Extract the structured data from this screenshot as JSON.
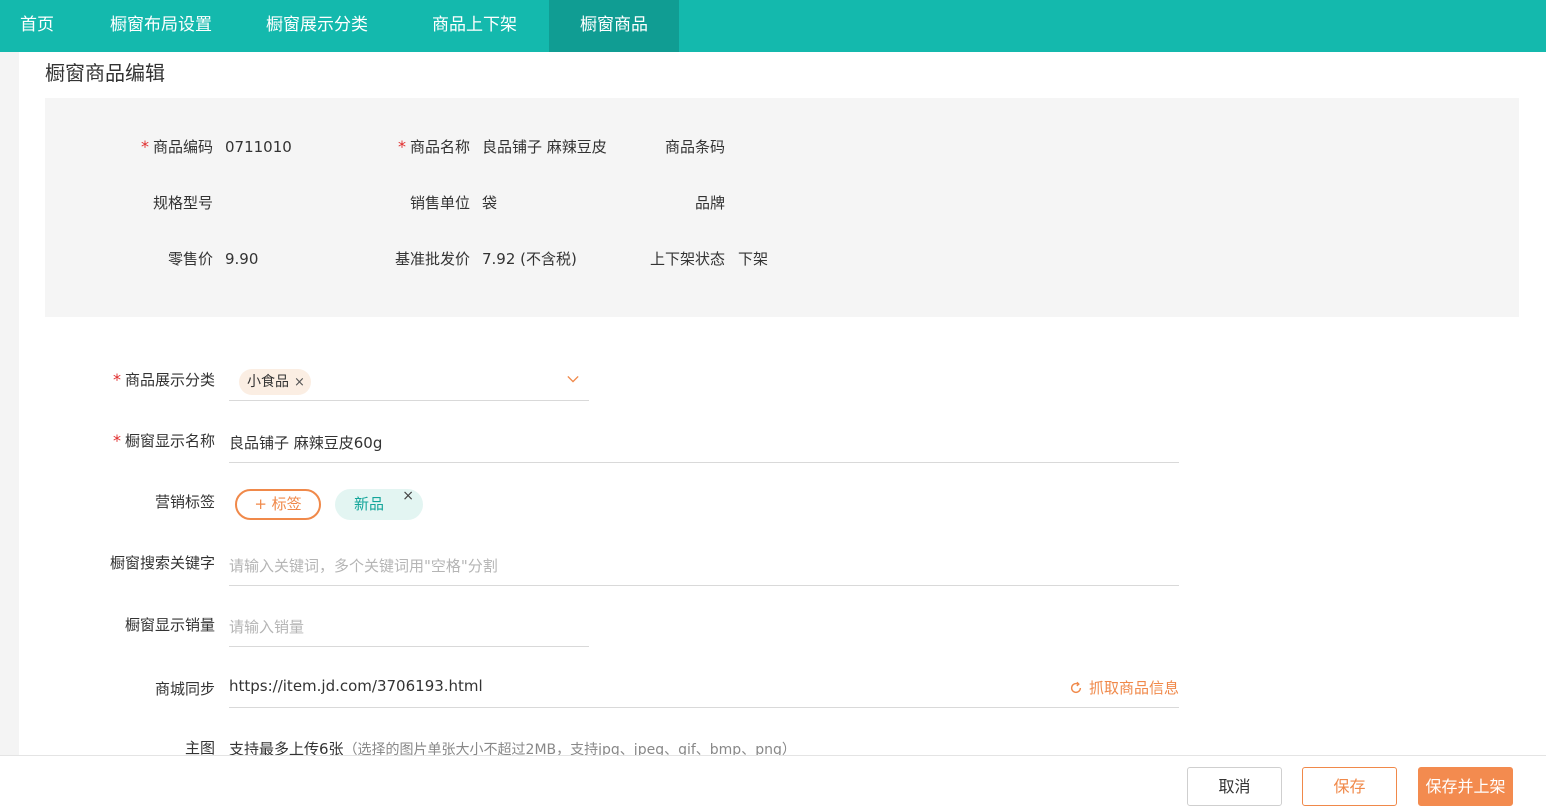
{
  "nav": {
    "items": [
      {
        "label": "首页",
        "active": false
      },
      {
        "label": "橱窗布局设置",
        "active": false
      },
      {
        "label": "橱窗展示分类",
        "active": false
      },
      {
        "label": "商品上下架",
        "active": false
      },
      {
        "label": "橱窗商品",
        "active": true
      }
    ]
  },
  "page": {
    "title": "橱窗商品编辑"
  },
  "info": {
    "required_mark": "*",
    "code_label": "商品编码",
    "code_value": "0711010",
    "name_label": "商品名称",
    "name_value": "良品铺子 麻辣豆皮",
    "barcode_label": "商品条码",
    "barcode_value": "",
    "spec_label": "规格型号",
    "spec_value": "",
    "unit_label": "销售单位",
    "unit_value": "袋",
    "brand_label": "品牌",
    "brand_value": "",
    "retail_label": "零售价",
    "retail_value": "9.90",
    "wholesale_label": "基准批发价",
    "wholesale_value": "7.92 (不含税)",
    "status_label": "上下架状态",
    "status_value": "下架"
  },
  "form": {
    "category_label": "商品展示分类",
    "category_chip": "小食品",
    "chip_remove": "×",
    "display_name_label": "橱窗显示名称",
    "display_name_value": "良品铺子 麻辣豆皮60g",
    "tags_label": "营销标签",
    "tag_add_label": "+ 标签",
    "tags": [
      {
        "label": "新品"
      }
    ],
    "keywords_label": "橱窗搜索关键字",
    "keywords_placeholder": "请输入关键词，多个关键词用\"空格\"分割",
    "sales_label": "橱窗显示销量",
    "sales_placeholder": "请输入销量",
    "sync_label": "商城同步",
    "sync_value": "https://item.jd.com/3706193.html",
    "fetch_label": "抓取商品信息",
    "main_image_label": "主图",
    "upload_tip": "支持最多上传6张",
    "upload_sub": "（选择的图片单张大小不超过2MB，支持jpg、jpeg、gif、bmp、png）"
  },
  "footer": {
    "cancel_label": "取消",
    "save_label": "保存",
    "publish_label": "保存并上架"
  },
  "colors": {
    "nav_bg": "#14b9ad",
    "nav_active": "#109d93",
    "accent_orange": "#f0894a",
    "required_red": "#e02b2b"
  }
}
